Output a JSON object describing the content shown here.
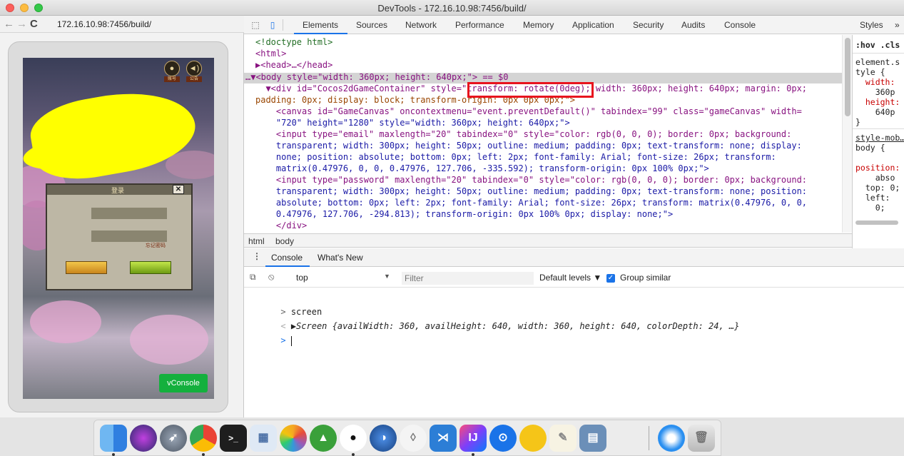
{
  "window": {
    "title": "DevTools - 172.16.10.98:7456/build/"
  },
  "browser": {
    "url": "172.16.10.98:7456/build/",
    "game": {
      "icon_labels": [
        "账号",
        "公告"
      ],
      "dialog_title": "登录",
      "dialog_close": "✕",
      "remember_label": "忘记密码",
      "vconsole_label": "vConsole"
    }
  },
  "devtools": {
    "tabs": [
      "Elements",
      "Sources",
      "Network",
      "Performance",
      "Memory",
      "Application",
      "Security",
      "Audits",
      "Console"
    ],
    "active_tab": "Elements",
    "elements_lines": [
      "<!doctype html>",
      "<html>",
      "▶<head>…</head>",
      "…▼<body style=\"width: 360px; height: 640px;\"> == $0",
      "  ▼<div id=\"Cocos2dGameContainer\" style=\"transform: rotate(0deg); width: 360px; height: 640px; margin: 0px;",
      "padding: 0px; display: block; transform-origin: 0px 0px 0px;\">",
      "    <canvas id=\"GameCanvas\" oncontextmenu=\"event.preventDefault()\" tabindex=\"99\" class=\"gameCanvas\" width=",
      "    \"720\" height=\"1280\" style=\"width: 360px; height: 640px;\">",
      "    <input type=\"email\" maxlength=\"20\" tabindex=\"0\" style=\"color: rgb(0, 0, 0); border: 0px; background:",
      "    transparent; width: 300px; height: 50px; outline: medium; padding: 0px; text-transform: none; display:",
      "    none; position: absolute; bottom: 0px; left: 2px; font-family: Arial; font-size: 26px; transform:",
      "    matrix(0.47976, 0, 0, 0.47976, 127.706, -335.592); transform-origin: 0px 100% 0px;\">",
      "    <input type=\"password\" maxlength=\"20\" tabindex=\"0\" style=\"color: rgb(0, 0, 0); border: 0px; background:",
      "    transparent; width: 300px; height: 50px; outline: medium; padding: 0px; text-transform: none; position:",
      "    absolute; bottom: 0px; left: 2px; font-family: Arial; font-size: 26px; transform: matrix(0.47976, 0, 0,",
      "    0.47976, 127.706, -294.813); transform-origin: 0px 100% 0px; display: none;\">",
      "    </div>"
    ],
    "breadcrumbs": [
      "html",
      "body"
    ],
    "styles": {
      "tab_label": "Styles",
      "more": "»",
      "hov_cls": ":hov .cls",
      "lines": [
        "element.s",
        "tyle {",
        "  width:",
        "    360p",
        "  height:",
        "    640p",
        "}",
        "style-mob…",
        "body {",
        "",
        "position:",
        "    abso",
        "  top: 0;",
        "  left:",
        "    0;"
      ]
    },
    "drawer": {
      "tabs": [
        "Console",
        "What's New"
      ],
      "context": "top",
      "filter_placeholder": "Filter",
      "levels": "Default levels ▼",
      "group_similar": "Group similar"
    },
    "console_lines": [
      {
        "prompt": ">",
        "text": "screen"
      },
      {
        "prompt": "<",
        "text": "▶Screen {availWidth: 360, availHeight: 640, width: 360, height: 640, colorDepth: 24, …}"
      },
      {
        "prompt": ">",
        "text": ""
      }
    ]
  },
  "dock": {
    "apps": [
      "finder-icon",
      "siri-icon",
      "launchpad-icon",
      "chrome-icon",
      "terminal-icon",
      "preview-icon",
      "photos-icon",
      "cocos-icon",
      "qq-icon",
      "browser-icon",
      "drop-icon",
      "vscode-icon",
      "intellij-icon",
      "maps-icon",
      "peanut-icon",
      "textedit-icon",
      "transmit-icon",
      "network-icon",
      "trash-icon"
    ],
    "jb_label": "IJ"
  }
}
